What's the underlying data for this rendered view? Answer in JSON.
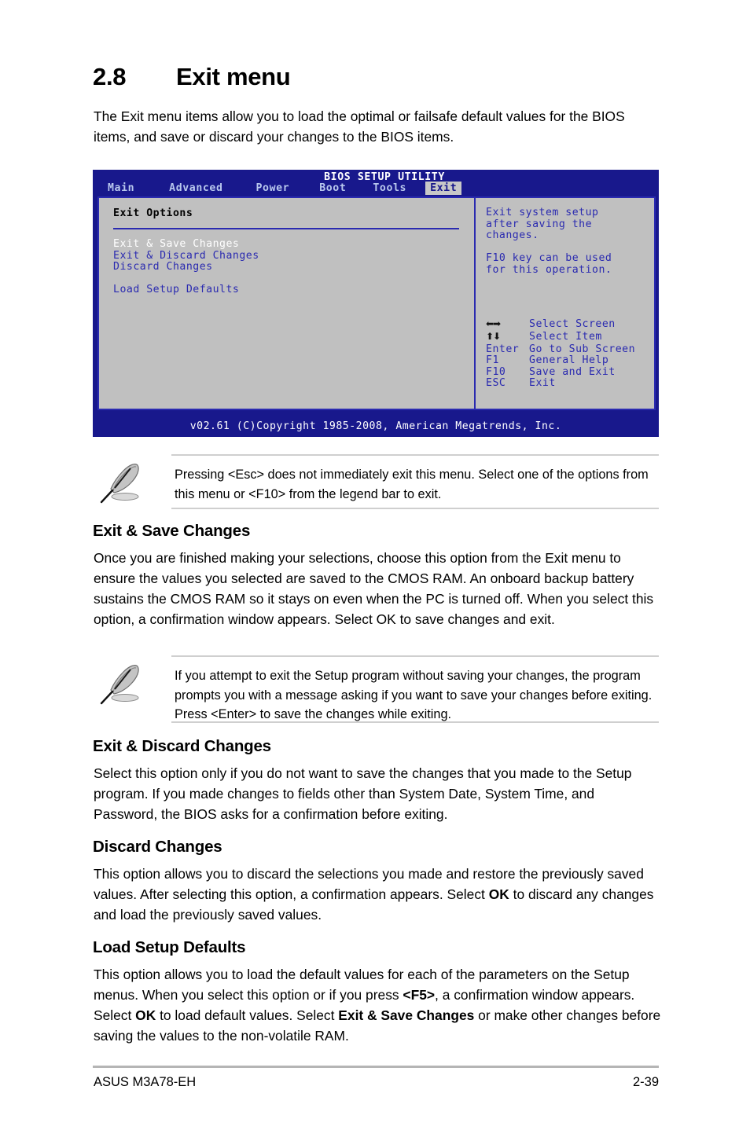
{
  "section": {
    "number": "2.8",
    "title": "Exit menu",
    "intro": "The Exit menu items allow you to load the optimal or failsafe default values for the BIOS items, and save or discard your changes to the BIOS items."
  },
  "bios": {
    "utility_title": "BIOS SETUP UTILITY",
    "tabs": [
      {
        "label": "Main",
        "active": false
      },
      {
        "label": "Advanced",
        "active": false
      },
      {
        "label": "Power",
        "active": false
      },
      {
        "label": "Boot",
        "active": false
      },
      {
        "label": "Tools",
        "active": false
      },
      {
        "label": "Exit",
        "active": true
      }
    ],
    "panel_title": "Exit Options",
    "options": [
      {
        "label": "Exit & Save Changes",
        "selected": true
      },
      {
        "label": "Exit & Discard Changes",
        "selected": false
      },
      {
        "label": "Discard Changes",
        "selected": false
      },
      {
        "label": "Load Setup Defaults",
        "selected": false
      }
    ],
    "help": {
      "line1": "Exit system setup",
      "line2": "after saving the",
      "line3": "changes.",
      "line4": "F10 key can be used",
      "line5": "for this operation."
    },
    "legend": [
      {
        "key": "←→",
        "desc": "Select Screen",
        "icon": "left-right-arrow-icon"
      },
      {
        "key": "↑↓",
        "desc": "Select Item",
        "icon": "up-down-arrow-icon"
      },
      {
        "key": "Enter",
        "desc": "Go to Sub Screen",
        "icon": ""
      },
      {
        "key": "F1",
        "desc": "General Help",
        "icon": ""
      },
      {
        "key": "F10",
        "desc": "Save and Exit",
        "icon": ""
      },
      {
        "key": "ESC",
        "desc": "Exit",
        "icon": ""
      }
    ],
    "copyright": "v02.61 (C)Copyright 1985-2008, American Megatrends, Inc.",
    "colors": {
      "chrome": "#18188c",
      "panel": "#c0c0c0",
      "panel_border": "#2a2ab0",
      "text": "#2a2ab0",
      "tab_text": "#b9c8ee",
      "active_tab_bg": "#c8c8c8",
      "selected_item": "#ffffff"
    }
  },
  "notes": [
    {
      "icon": "note-pencil-icon",
      "text": "Pressing <Esc> does not immediately exit this menu. Select one of the options from this menu or <F10> from the legend bar to exit."
    },
    {
      "icon": "note-pencil-icon",
      "text": " If you attempt to exit the Setup program without saving your changes, the program prompts you with a message asking if you want to save your changes before exiting. Press <Enter>  to save the  changes while exiting."
    }
  ],
  "sections": [
    {
      "heading": "Exit & Save Changes",
      "body": "Once you are finished making your selections, choose this option from the Exit menu to ensure the values you selected are saved to the CMOS RAM. An onboard backup battery sustains the CMOS RAM so it stays on even when the PC is turned off. When you select this option, a confirmation window appears. Select OK to save changes and exit."
    },
    {
      "heading": "Exit & Discard Changes",
      "body": "Select this option only if you do not want to save the changes that you  made to the Setup program. If you made changes to fields other than System Date, System Time, and Password, the BIOS asks for a confirmation before exiting."
    },
    {
      "heading": "Discard Changes",
      "body_pre": "This option allows you to discard the selections you made and restore the previously saved values. After selecting this option, a confirmation appears. Select ",
      "body_bold": "OK",
      "body_post": " to discard any changes and load the previously saved values."
    },
    {
      "heading": "Load Setup Defaults",
      "body_a": "This option allows you to load the default values for each of the parameters on the Setup menus. When you select this option or if you press ",
      "bold_f5": "<F5>",
      "body_b": ", a confirmation window appears. Select ",
      "bold_ok": "OK",
      "body_c": " to load default values. Select ",
      "bold_exitsave": "Exit & Save Changes",
      "body_d": " or make other changes before saving the values to the non-volatile RAM."
    }
  ],
  "footer": {
    "left": "ASUS M3A78-EH",
    "page": "2-39"
  }
}
